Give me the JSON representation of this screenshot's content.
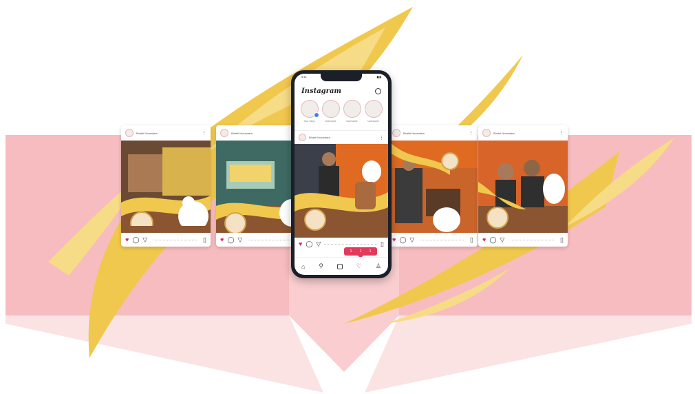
{
  "phone": {
    "status": {
      "time": "9:41",
      "signal": "▮▮▮"
    },
    "app_logo": "Instagram",
    "stories": [
      {
        "label": "Your Story"
      },
      {
        "label": "Username"
      },
      {
        "label": "Username"
      },
      {
        "label": "Username"
      }
    ],
    "post_user": "Bhakti Nusantara",
    "notification": {
      "likes": "1",
      "comments": "1",
      "follows": "1"
    }
  },
  "posts": [
    {
      "user": "Bhakti Nusantara"
    },
    {
      "user": "Bhakti Nusantara"
    },
    {
      "user": "Bhakti Nusantara"
    },
    {
      "user": "Bhakti Nusantara"
    }
  ],
  "icons": {
    "heart": "♥",
    "comment": "◯",
    "share": "▽",
    "bookmark": "▯",
    "more": "⋮",
    "home": "⌂",
    "search": "⚲",
    "add": "□",
    "activity": "♡",
    "profile": "♙"
  },
  "colors": {
    "gold": "#f1c84e",
    "light_gold": "#f6dc86",
    "pink": "#f6b5b8",
    "brown": "#8a5530",
    "orange": "#e06a22",
    "instagram_red": "#e23a5c"
  }
}
